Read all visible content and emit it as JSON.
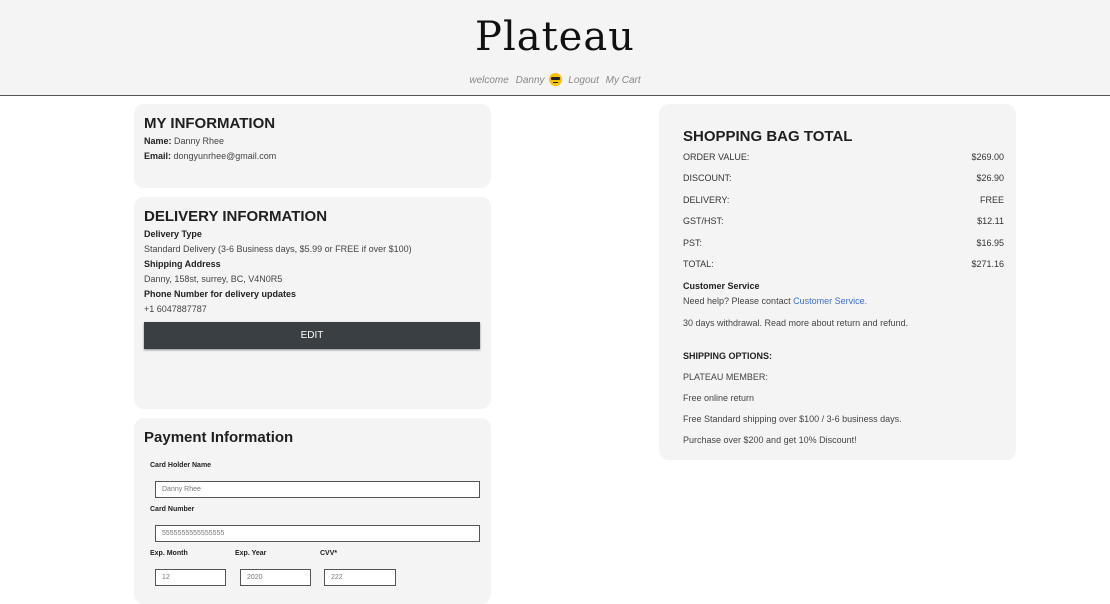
{
  "header": {
    "logo": "Plateau",
    "welcome": "welcome",
    "user": "Danny",
    "emoji_icon": "sunglasses-emoji-icon",
    "logout": "Logout",
    "cart": "My Cart"
  },
  "my_info": {
    "title": "MY INFORMATION",
    "name_label": "Name:",
    "name_value": "Danny Rhee",
    "email_label": "Email:",
    "email_value": "dongyunrhee@gmail.com"
  },
  "delivery": {
    "title": "DELIVERY INFORMATION",
    "type_label": "Delivery Type",
    "type_value": "Standard Delivery (3-6 Business days, $5.99 or FREE if over $100)",
    "address_label": "Shipping Address",
    "address_value": "Danny, 158st, surrey, BC, V4N0R5",
    "phone_label": "Phone Number for delivery updates",
    "phone_value": "+1 6047887787",
    "edit_label": "EDIT"
  },
  "payment": {
    "title": "Payment Information",
    "holder_label": "Card Holder Name",
    "holder_value": "Danny Rhee",
    "number_label": "Card Number",
    "number_value": "5555555555555555",
    "month_label": "Exp. Month",
    "month_value": "12",
    "year_label": "Exp. Year",
    "year_value": "2020",
    "cvv_label": "CVV*",
    "cvv_value": "222"
  },
  "summary": {
    "title": "SHOPPING BAG TOTAL",
    "rows": [
      {
        "label": "ORDER VALUE:",
        "value": "$269.00"
      },
      {
        "label": "DISCOUNT:",
        "value": "$26.90"
      },
      {
        "label": "DELIVERY:",
        "value": "FREE"
      },
      {
        "label": "GST/HST:",
        "value": "$12.11"
      },
      {
        "label": "PST:",
        "value": "$16.95"
      },
      {
        "label": "TOTAL:",
        "value": "$271.16"
      }
    ],
    "cs_title": "Customer Service",
    "cs_text": "Need help? Please contact",
    "cs_link": "Customer Service.",
    "withdrawal": "30 days withdrawal. Read more about return and refund.",
    "shipping_title": "SHIPPING OPTIONS:",
    "member": "PLATEAU MEMBER:",
    "opt1": "Free online return",
    "opt2": "Free Standard shipping over $100 / 3-6 business days.",
    "opt3": "Purchase over $200 and get 10% Discount!"
  }
}
